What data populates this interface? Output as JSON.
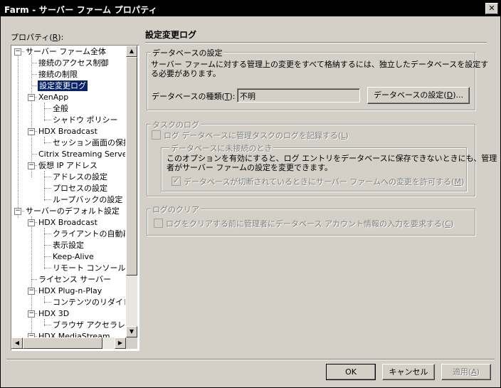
{
  "window": {
    "title": "Farm - サーバー ファーム プロパティ",
    "close_glyph": "✕"
  },
  "properties_label": "プロパティ(",
  "properties_key": "R",
  "properties_suffix": "):",
  "tree": {
    "items": [
      {
        "label": "サーバー ファーム全体",
        "expander": "−"
      },
      {
        "label": "接続のアクセス制御"
      },
      {
        "label": "接続の制限"
      },
      {
        "label": "設定変更ログ"
      },
      {
        "label": "XenApp",
        "expander": "−"
      },
      {
        "label": "全般"
      },
      {
        "label": "シャドウ ポリシー"
      },
      {
        "label": "HDX Broadcast",
        "expander": "−"
      },
      {
        "label": "セッション画面の保持"
      },
      {
        "label": "Citrix Streaming Server"
      },
      {
        "label": "仮想 IP アドレス",
        "expander": "−"
      },
      {
        "label": "アドレスの設定"
      },
      {
        "label": "プロセスの設定"
      },
      {
        "label": "ループバックの設定"
      },
      {
        "label": "サーバーのデフォルト設定",
        "expander": "−"
      },
      {
        "label": "HDX Broadcast",
        "expander": "−"
      },
      {
        "label": "クライアントの自動再接続"
      },
      {
        "label": "表示設定"
      },
      {
        "label": "Keep-Alive"
      },
      {
        "label": "リモート コンソール接続"
      },
      {
        "label": "ライセンス サーバー"
      },
      {
        "label": "HDX Plug-n-Play",
        "expander": "−"
      },
      {
        "label": "コンテンツのリダイレクト"
      },
      {
        "label": "HDX 3D",
        "expander": "−"
      },
      {
        "label": "ブラウザ アクセラレーション"
      },
      {
        "label": "HDX MediaStream",
        "expander": "−"
      }
    ],
    "scroll_up": "▲",
    "scroll_down": "▼",
    "scroll_left": "◀",
    "scroll_right": "▶"
  },
  "page_title": "設定変更ログ",
  "db_group": {
    "title": "データベースの設定",
    "desc_line1": "サーバー ファームに対する管理上の変更をすべて格納するには、独立したデータベースを設定す",
    "desc_line2": "る必要があります。",
    "type_label": "データベースの種類(",
    "type_key": "T",
    "type_suffix": "):",
    "type_value": "不明",
    "settings_button_pre": "データベースの設定(",
    "settings_button_key": "D",
    "settings_button_post": ")..."
  },
  "task_group": {
    "title": "タスクのログ",
    "log_check_label": "ログ データベースに管理タスクのログを記録する(",
    "log_check_key": "L",
    "log_check_suffix": ")",
    "offline_group": {
      "title": "データベースに未接続のとき",
      "desc_line1": "このオプションを有効にすると、ログ エントリをデータベースに保存できないときにも、管理",
      "desc_line2": "者がサーバー ファームの設定を変更できます。",
      "allow_check_label": "データベースが切断されているときにサーバー ファームへの変更を許可する(",
      "allow_check_key": "M",
      "allow_check_suffix": ")",
      "allow_check_mark": "✓"
    }
  },
  "clear_group": {
    "title": "ログのクリア",
    "check_label": "ログをクリアする前に管理者にデータベース アカウント情報の入力を要求する(",
    "check_key": "C",
    "check_suffix": ")"
  },
  "buttons": {
    "ok": "OK",
    "cancel": "キャンセル",
    "apply_pre": "適用(",
    "apply_key": "A",
    "apply_post": ")"
  }
}
